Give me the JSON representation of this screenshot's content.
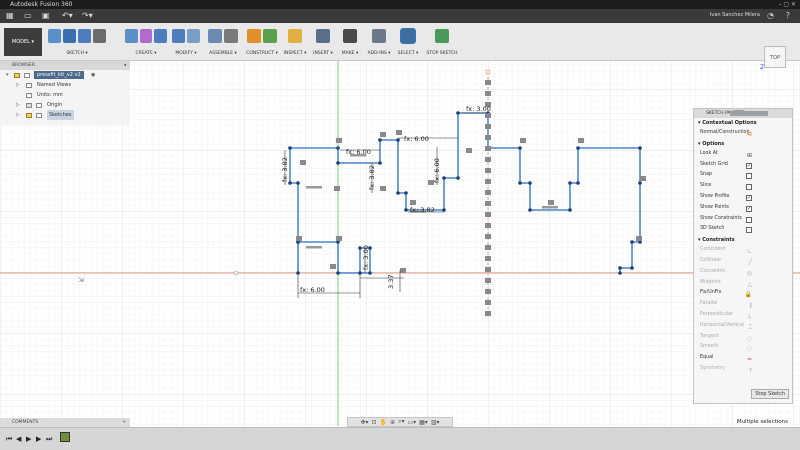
{
  "window": {
    "title": "Autodesk Fusion 360",
    "controls": "–  ▢  ✕"
  },
  "qat": {
    "user": "Ivan Sanchez Milera",
    "icons": [
      "grid-icon",
      "file-icon",
      "save-icon",
      "undo-icon",
      "redo-icon"
    ]
  },
  "ribbon": {
    "workspace": "MODEL",
    "groups": [
      {
        "label": "SKETCH ▾",
        "colors": [
          "#5a8fc8",
          "#3b6fb0",
          "#4d7dbd",
          "#6c6c6c"
        ]
      },
      {
        "label": "CREATE ▾",
        "colors": [
          "#5a8fc8",
          "#b06ad0",
          "#4d7dbd"
        ]
      },
      {
        "label": "MODIFY ▾",
        "colors": [
          "#4d7dbd",
          "#7b9ec8"
        ]
      },
      {
        "label": "ASSEMBLE ▾",
        "colors": [
          "#6a8ab0",
          "#7a7a7a"
        ]
      },
      {
        "label": "CONSTRUCT ▾",
        "colors": [
          "#e0902a",
          "#5aa04a"
        ]
      },
      {
        "label": "INSPECT ▾",
        "colors": [
          "#e0b040"
        ]
      },
      {
        "label": "INSERT ▾",
        "colors": [
          "#5b6f88"
        ]
      },
      {
        "label": "MAKE ▾",
        "colors": [
          "#4a4a4a"
        ]
      },
      {
        "label": "ADD-INS ▾",
        "colors": [
          "#6a7a8a"
        ]
      },
      {
        "label": "SELECT ▾",
        "colors": [
          "#3d6e9e"
        ]
      },
      {
        "label": "STOP SKETCH",
        "colors": [
          "#4a9a5a"
        ]
      }
    ]
  },
  "browser": {
    "header": "BROWSER",
    "root": "pressfit_kit_v2 v2",
    "items": [
      "Named Views",
      "Units: mm",
      "Origin",
      "Sketches"
    ]
  },
  "viewcube": {
    "face": "TOP",
    "axis": "Z"
  },
  "sketch": {
    "dimensions": [
      "fx: 3.00",
      "fx: 6.00",
      "fx: 6.00",
      "fx: 3.82",
      "fx: 3.82",
      "fx: 6.00",
      "fx: 3.82",
      "fx: 3.00",
      "fx: 6.00",
      "3.37"
    ]
  },
  "palette": {
    "title": "SKETCH PALETTE",
    "sections": {
      "contextual": "Contextual Options",
      "options": "Options",
      "constraints": "Constraints"
    },
    "contextual_items": [
      {
        "label": "Normal/Construction"
      }
    ],
    "option_items": [
      {
        "label": "Look At",
        "type": "icon"
      },
      {
        "label": "Sketch Grid",
        "checked": "✓"
      },
      {
        "label": "Snap",
        "checked": ""
      },
      {
        "label": "Slice",
        "checked": ""
      },
      {
        "label": "Show Profile",
        "checked": "✓"
      },
      {
        "label": "Show Points",
        "checked": "✓"
      },
      {
        "label": "Show Constraints",
        "checked": ""
      },
      {
        "label": "3D Sketch",
        "checked": ""
      }
    ],
    "constraint_items": [
      {
        "label": "Coincident",
        "enabled": false
      },
      {
        "label": "Collinear",
        "enabled": false
      },
      {
        "label": "Concentric",
        "enabled": false
      },
      {
        "label": "Midpoint",
        "enabled": false
      },
      {
        "label": "Fix/UnFix",
        "enabled": true
      },
      {
        "label": "Parallel",
        "enabled": false
      },
      {
        "label": "Perpendicular",
        "enabled": false
      },
      {
        "label": "Horizontal/Vertical",
        "enabled": false
      },
      {
        "label": "Tangent",
        "enabled": false
      },
      {
        "label": "Smooth",
        "enabled": false
      },
      {
        "label": "Equal",
        "enabled": true
      },
      {
        "label": "Symmetry",
        "enabled": false
      }
    ],
    "stop_label": "Stop Sketch"
  },
  "status": {
    "selection": "Multiple selections"
  },
  "comments": {
    "label": "COMMENTS",
    "plus": "+"
  },
  "timeline": {
    "buttons": [
      "⏮",
      "◀",
      "▶",
      "▶",
      "⏭"
    ]
  },
  "colors": {
    "sketch_line": "#2b6cc4",
    "point": "#1a3f7a",
    "construction": "#e07b62",
    "origin_green": "#63c163"
  }
}
